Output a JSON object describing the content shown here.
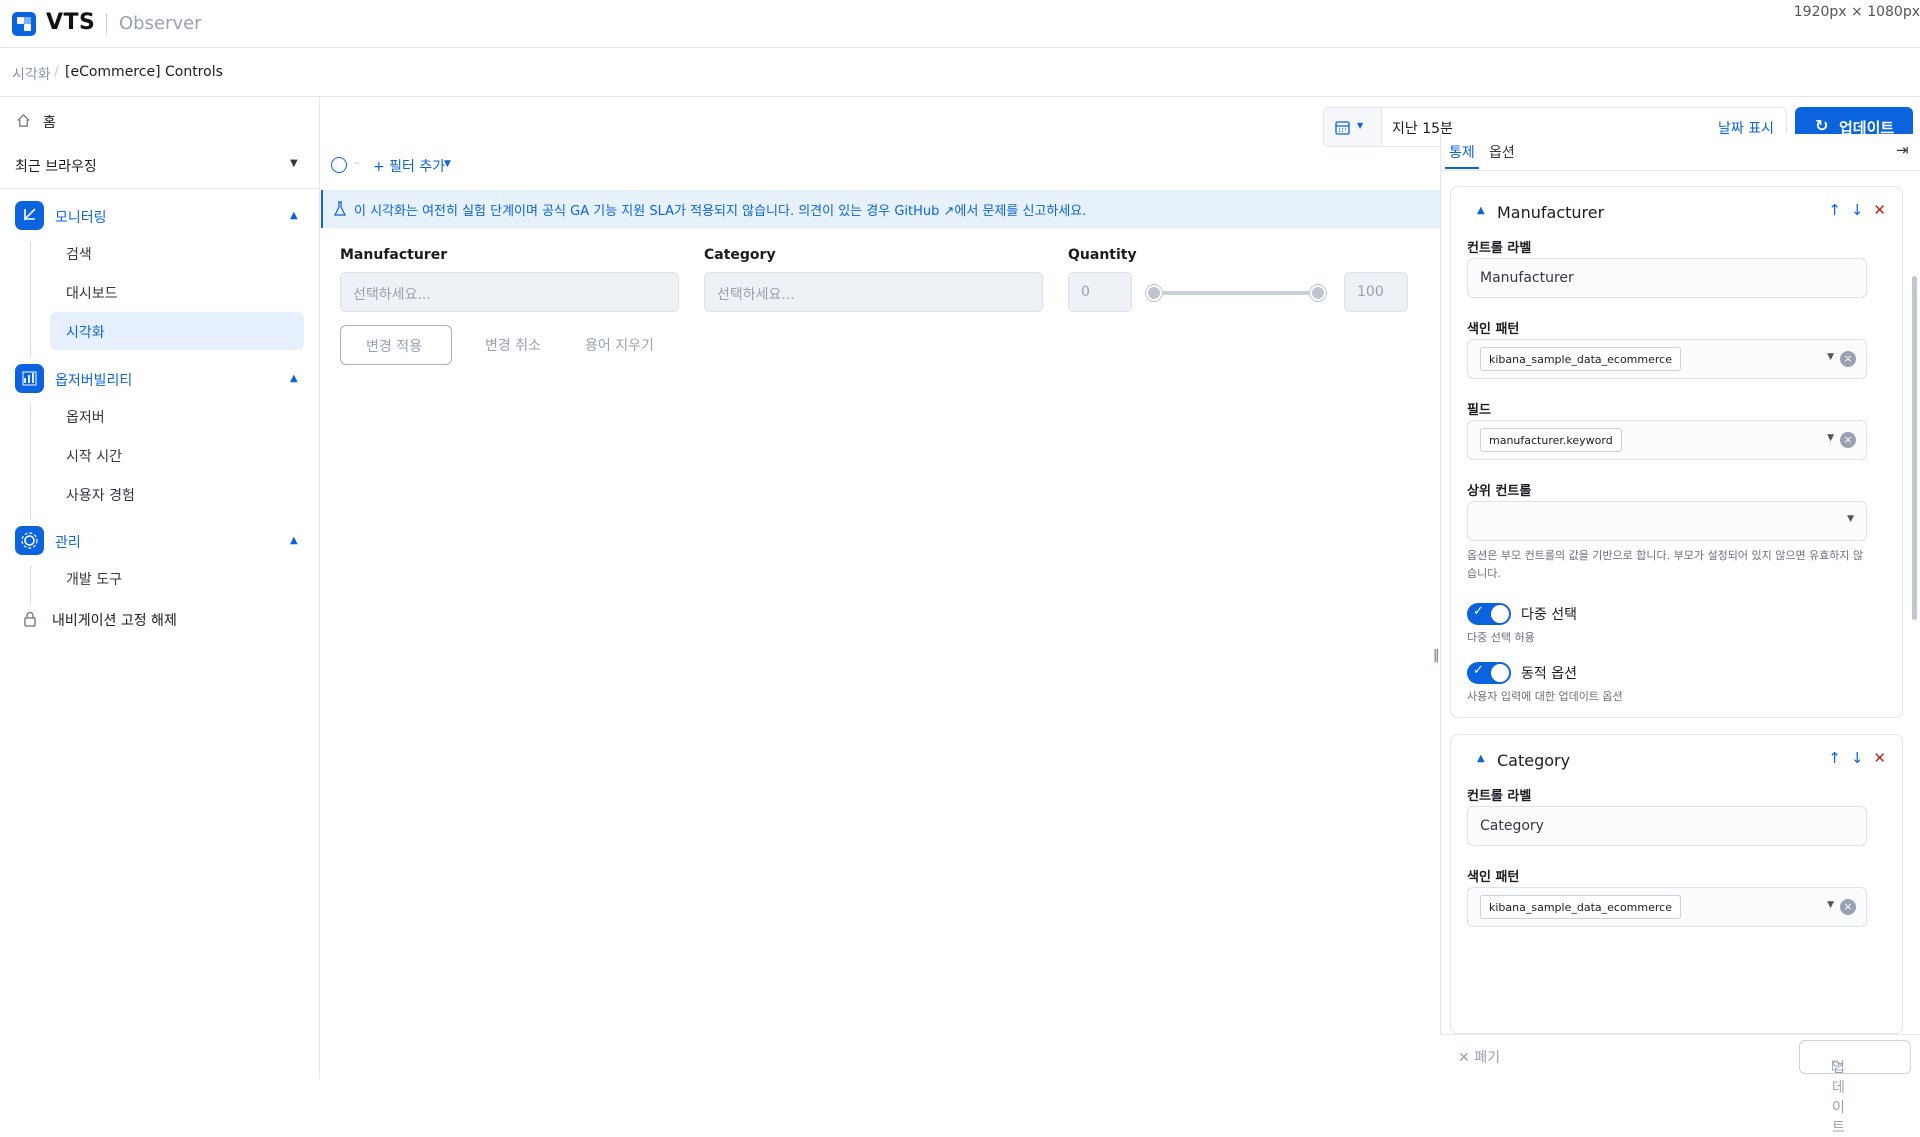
{
  "header": {
    "logo": "VTS",
    "app_name": "Observer",
    "dimensions": "1920px × 1080px"
  },
  "breadcrumb": {
    "items": [
      "시각화",
      "[eCommerce] Controls"
    ]
  },
  "sidebar": {
    "home": "홈",
    "recent": "최근 브라우징",
    "sections": [
      {
        "label": "모니터링",
        "items": [
          "검색",
          "대시보드",
          "시각화"
        ],
        "active": "시각화"
      },
      {
        "label": "옵저버빌리티",
        "items": [
          "옵저버",
          "시작 시간",
          "사용자 경험"
        ]
      },
      {
        "label": "관리",
        "items": [
          "개발 도구"
        ]
      }
    ],
    "unpin": "내비게이션 고정 해제"
  },
  "toolbar": {
    "add_filter": "+ 필터 추가",
    "date_value": "지난 15분",
    "date_show": "날짜 표시",
    "update": "업데이트"
  },
  "callout": {
    "text": "이 시각화는 여전히 실험 단계이며 공식 GA 기능 지원 SLA가 적용되지 않습니다. 의견이 있는 경우 GitHub ↗에서 문제를 신고하세요."
  },
  "controls": {
    "manufacturer_label": "Manufacturer",
    "manufacturer_placeholder": "선택하세요...",
    "category_label": "Category",
    "category_placeholder": "선택하세요...",
    "quantity_label": "Quantity",
    "quantity_min": "0",
    "quantity_max": "100",
    "apply": "변경 적용",
    "cancel": "변경 취소",
    "clear": "용어 지우기"
  },
  "panel": {
    "tabs": [
      "통제",
      "옵션"
    ],
    "active_tab": "통제",
    "cards": [
      {
        "title": "Manufacturer",
        "control_label_title": "컨트롤 라벨",
        "control_label_value": "Manufacturer",
        "index_title": "색인 패턴",
        "index_value": "kibana_sample_data_ecommerce",
        "field_title": "필드",
        "field_value": "manufacturer.keyword",
        "parent_title": "상위 컨트롤",
        "parent_help": "옵션은 부모 컨트롤의 값을 기반으로 합니다. 부모가 설정되어 있지 않으면 유효하지 않습니다.",
        "multi_label": "다중 선택",
        "multi_help": "다중 선택 허용",
        "dynamic_label": "동적 옵션",
        "dynamic_help": "사용자 입력에 대한 업데이트 옵션"
      },
      {
        "title": "Category",
        "control_label_title": "컨트롤 라벨",
        "control_label_value": "Category",
        "index_title": "색인 패턴",
        "index_value": "kibana_sample_data_ecommerce"
      }
    ],
    "discard": "폐기",
    "update": "업데이트"
  },
  "colors": {
    "accent": "#0b64dd",
    "danger": "#bd271e",
    "callout_bg": "#e6f1fa"
  }
}
